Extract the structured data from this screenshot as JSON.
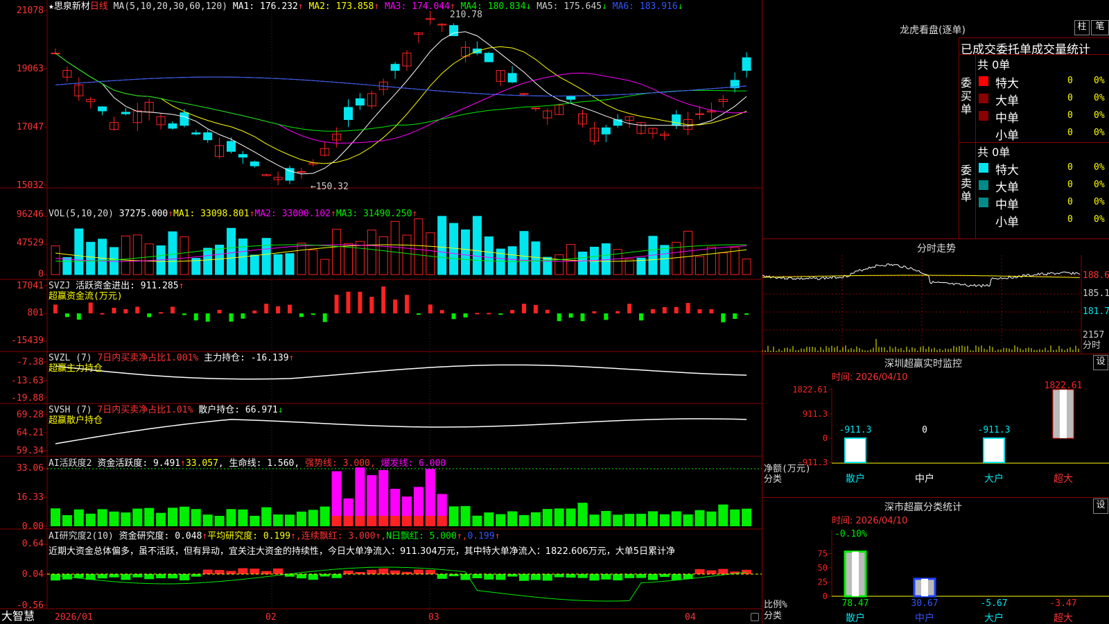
{
  "colors": {
    "up": "#ff2222",
    "down": "#00e5ee",
    "grid": "#8b0000",
    "green": "#00ee00",
    "magenta": "#ff00ff",
    "yellow": "#ffff00",
    "white": "#ffffff"
  },
  "kline": {
    "stock_name": "★思泉新材",
    "period": "日线",
    "ma_label": "MA(5,10,20,30,60,120)",
    "ma1": "MA1: 176.232",
    "ma2": "MA2: 173.858",
    "ma3": "MA3: 174.044",
    "ma4": "MA4: 180.834",
    "ma5": "MA5: 175.645",
    "ma6": "MA6: 183.916",
    "arrow_up": "↑",
    "arrow_down": "↓",
    "y_ticks": [
      "21078",
      "19063",
      "17047",
      "15032"
    ],
    "high_label": "210.78",
    "low_label": "←150.32"
  },
  "vol": {
    "label": "VOL(5,10,20)",
    "val": "37275.000",
    "ma1": "MA1: 33098.801",
    "ma2": "MA2: 33000.102",
    "ma3": "MA3: 31490.250",
    "y_ticks": [
      "96246",
      "47529",
      "0"
    ]
  },
  "svzj": {
    "title": "SVZJ",
    "l1": "活跃资金进出: 911.285",
    "l2": "超赢资金流(万元)",
    "y_ticks": [
      "17041",
      "801",
      "-15439"
    ]
  },
  "svzl": {
    "title": "SVZL (7)",
    "l1": "7日内买卖净占比1.001%",
    "l2": "主力持仓: -16.139",
    "l3": "超赢主力持仓",
    "y_ticks": [
      "-7.38",
      "-13.63",
      "-19.88"
    ]
  },
  "svsh": {
    "title": "SVSH (7)",
    "l1": "7日内买卖净占比1.01%",
    "l2": "散户持仓: 66.971",
    "l3": "超赢散户持仓",
    "y_ticks": [
      "69.28",
      "64.21",
      "59.34"
    ]
  },
  "ai1": {
    "title": "AI活跃度2",
    "l1": "资金活跃度: 9.491",
    "l2": "33.057",
    "l3": "生命线: 1.560",
    "l4": "强势线: 3.000",
    "l5": "爆发线: 6.000",
    "y_ticks": [
      "33.06",
      "16.33",
      "0.00"
    ]
  },
  "ai2": {
    "title": "AI研究度2(10)",
    "l1": "资金研究度: 0.048",
    "l2": "平均研究度: 0.199",
    "l3": "连续飘红: 3.000",
    "l4": "N日飘红: 5.000",
    "l5": "0.199",
    "note": "近期大资金总体偏多，虽不活跃，但有异动，宜关注大资金的持续性，今日大单净流入：911.304万元，其中特大单净流入：1822.606万元，大单5日累计净",
    "y_ticks": [
      "0.64",
      "0.04",
      "-0.56"
    ]
  },
  "xaxis": {
    "brand": "大智慧",
    "labels": [
      "2026/01",
      "02",
      "03",
      "04"
    ]
  },
  "dragon": {
    "title": "龙虎看盘(逐单)",
    "btn1": "柱",
    "btn2": "笔",
    "sub": "已成交委托单成交量统计",
    "buy_total": "共 0单",
    "buy_label": "委买单",
    "sell_total": "共 0单",
    "sell_label": "委卖单",
    "rows": [
      {
        "name": "特大",
        "v": "0",
        "p": "0%"
      },
      {
        "name": "大单",
        "v": "0",
        "p": "0%"
      },
      {
        "name": "中单",
        "v": "0",
        "p": "0%"
      },
      {
        "name": "小单",
        "v": "0",
        "p": "0%"
      }
    ]
  },
  "minute": {
    "title": "分时走势",
    "p1": "188.6",
    "p2": "185.1",
    "p3": "181.7",
    "v": "2157",
    "vlabel": "分时"
  },
  "sz_monitor": {
    "title": "深圳超赢实时监控",
    "btn": "设",
    "time": "时间: 2026/04/10",
    "y_ticks": [
      "1822.61",
      "911.3",
      "0",
      "-911.3"
    ],
    "axis_label1": "净额(万元)",
    "axis_label2": "分类",
    "bars": [
      {
        "cat": "散户",
        "value": -911.3,
        "label": "-911.3"
      },
      {
        "cat": "中户",
        "value": 0,
        "label": "0"
      },
      {
        "cat": "大户",
        "value": -911.3,
        "label": "-911.3"
      },
      {
        "cat": "超大",
        "value": 1822.61,
        "label": "1822.61"
      }
    ]
  },
  "sz_class": {
    "title": "深市超赢分类统计",
    "btn": "设",
    "time": "时间: 2026/04/10",
    "top_label": "-0.10%",
    "y_ticks": [
      "75",
      "50",
      "25",
      "0"
    ],
    "axis_label1": "比例%",
    "axis_label2": "分类",
    "bars": [
      {
        "cat": "散户",
        "value": 78.47,
        "label": "78.47"
      },
      {
        "cat": "中户",
        "value": 30.67,
        "label": "30.67"
      },
      {
        "cat": "大户",
        "value": -5.67,
        "label": "-5.67"
      },
      {
        "cat": "超大",
        "value": -3.47,
        "label": "-3.47"
      }
    ]
  }
}
